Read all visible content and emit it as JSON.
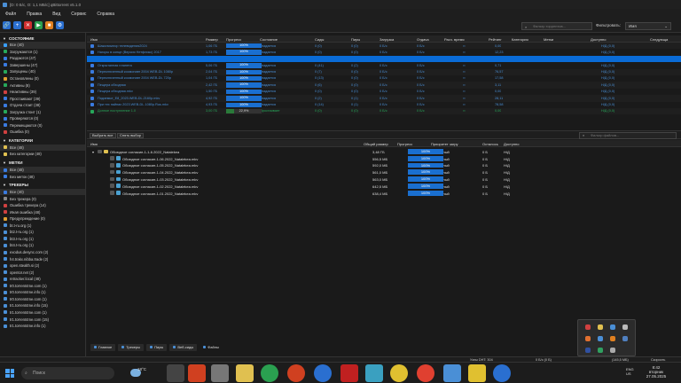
{
  "window": {
    "title": "[D: 0 Б/с, О: 1,1 МБ/с] qBittorrent v5.1.0"
  },
  "menu": [
    "Файл",
    "Правка",
    "Вид",
    "Сервис",
    "Справка"
  ],
  "toolbar": {
    "search_placeholder": "Фильтр торрентов...",
    "filter_label": "Фильтровать:",
    "filter_value": "Имя"
  },
  "sidebar": {
    "status_title": "СОСТОЯНИЕ",
    "status_items": [
      {
        "label": "Все (40)",
        "color": "#3aa0ff",
        "selected": true
      },
      {
        "label": "Загружаются (1)",
        "color": "#27a85a"
      },
      {
        "label": "Раздаются (47)",
        "color": "#3a7be0"
      },
      {
        "label": "Завершены (47)",
        "color": "#3a7be0"
      },
      {
        "label": "Запущены (40)",
        "color": "#27a85a"
      },
      {
        "label": "Остановлены (0)",
        "color": "#e0a030"
      },
      {
        "label": "Активны (8)",
        "color": "#27a85a"
      },
      {
        "label": "Неактивны (39)",
        "color": "#d04040"
      },
      {
        "label": "Простаивают (39)",
        "color": "#3a7be0"
      },
      {
        "label": "Отдача стоит (38)",
        "color": "#3a7be0"
      },
      {
        "label": "Загрузка стоит (1)",
        "color": "#27a85a"
      },
      {
        "label": "Проверяются (0)",
        "color": "#3a7be0"
      },
      {
        "label": "Перемещаются (0)",
        "color": "#3a7be0"
      },
      {
        "label": "Ошибка (0)",
        "color": "#d04040"
      }
    ],
    "categories_title": "КАТЕГОРИИ",
    "category_items": [
      {
        "label": "Все (48)",
        "color": "#e0c050",
        "selected": true
      },
      {
        "label": "Без категории (48)",
        "color": "#e0c050"
      }
    ],
    "tags_title": "МЕТКИ",
    "tag_items": [
      {
        "label": "Все (48)",
        "color": "#3a7be0",
        "selected": true
      },
      {
        "label": "Без меток (48)",
        "color": "#3a7be0"
      }
    ],
    "trackers_title": "ТРЕКЕРЫ",
    "tracker_items": [
      {
        "label": "Все (40)",
        "color": "#3a7be0",
        "selected": true
      },
      {
        "label": "Без трекера (0)",
        "color": "#888"
      },
      {
        "label": "Ошибка трекера (14)",
        "color": "#d04040"
      },
      {
        "label": "Иная ошибка (48)",
        "color": "#d04040"
      },
      {
        "label": "Предупреждение (0)",
        "color": "#e0a030"
      },
      {
        "label": "bt.t-ru.org (1)",
        "color": "#4a8fd6"
      },
      {
        "label": "bt2.t-ru.org (1)",
        "color": "#4a8fd6"
      },
      {
        "label": "bt3.t-ru.org (1)",
        "color": "#4a8fd6"
      },
      {
        "label": "bt4.t-ru.org (1)",
        "color": "#4a8fd6"
      },
      {
        "label": "exodus.desync.com (2)",
        "color": "#4a8fd6"
      },
      {
        "label": "h4.trakx.nibba.trade (2)",
        "color": "#4a8fd6"
      },
      {
        "label": "open.stealth.si (2)",
        "color": "#4a8fd6"
      },
      {
        "label": "opentor.net (2)",
        "color": "#4a8fd6"
      },
      {
        "label": "retracker.local (48)",
        "color": "#4a8fd6"
      },
      {
        "label": "tr0.torrent4me.com (1)",
        "color": "#4a8fd6"
      },
      {
        "label": "tr0.torrent4me.info (1)",
        "color": "#4a8fd6"
      },
      {
        "label": "tr0.torrent4me.com (1)",
        "color": "#4a8fd6"
      },
      {
        "label": "tr1.torrent4me.info (15)",
        "color": "#4a8fd6"
      },
      {
        "label": "tr1.torrent4me.com (1)",
        "color": "#4a8fd6"
      },
      {
        "label": "tr1.torrent4me.com (15)",
        "color": "#4a8fd6"
      },
      {
        "label": "tr1.torrent4me.info (1)",
        "color": "#4a8fd6"
      }
    ]
  },
  "torrent_table": {
    "columns": [
      "Имя",
      "Размер",
      "Прогресс",
      "Состояние",
      "Сиды",
      "Пиры",
      "Загрузка",
      "Отдача",
      "Расч. время",
      "Рейтинг",
      "Категория",
      "Метки",
      "Доступно",
      "Следующа"
    ],
    "rows": [
      {
        "name": "Шакализатор телевидения2024",
        "size": "1,06 ГБ",
        "progress": "100%",
        "state": "Раздается",
        "seeds": "0 (0)",
        "peers": "0 (0)",
        "down": "0 Б/с",
        "up": "0 Б/с",
        "eta": "∞",
        "ratio": "0,00",
        "avail": "Н/Д (0,0)"
      },
      {
        "name": "Нагоры в конце (Версия Нетфликс) 2017",
        "size": "1,73 ГБ",
        "progress": "100%",
        "state": "Раздается",
        "seeds": "0 (0)",
        "peers": "0 (0)",
        "down": "0 Б/с",
        "up": "0 Б/с",
        "eta": "∞",
        "ratio": "12,23",
        "avail": "Н/Д (0,0)"
      },
      {
        "name": "",
        "size": "",
        "progress": "",
        "state": "",
        "seeds": "",
        "peers": "",
        "down": "",
        "up": "",
        "eta": "",
        "ratio": "",
        "avail": "",
        "highlight": true
      },
      {
        "name": "Открытанная планета",
        "size": "5,06 ГБ",
        "progress": "100%",
        "state": "Раздается",
        "seeds": "0 (41)",
        "peers": "0 (2)",
        "down": "0 Б/с",
        "up": "0 Б/с",
        "eta": "∞",
        "ratio": "0,71",
        "avail": "Н/Д (0,0)"
      },
      {
        "name": "Переключенный космонавт 2004 WEB-DL 1080p",
        "size": "2,04 ГБ",
        "progress": "100%",
        "state": "Раздается",
        "seeds": "0 (7)",
        "peers": "0 (0)",
        "down": "0 Б/с",
        "up": "0 Б/с",
        "eta": "∞",
        "ratio": "76,57",
        "avail": "Н/Д (0,0)"
      },
      {
        "name": "Переключенный космонавт 2004 WEB-DL 720p",
        "size": "1,04 ГБ",
        "progress": "100%",
        "state": "Раздается",
        "seeds": "0 (13)",
        "peers": "0 (0)",
        "down": "0 Б/с",
        "up": "0 Б/с",
        "eta": "∞",
        "ratio": "17,58",
        "avail": "Н/Д (0,0)"
      },
      {
        "name": "Пещера обходная",
        "size": "2,42 ГБ",
        "progress": "100%",
        "state": "Раздается",
        "seeds": "0 (6)",
        "peers": "0 (0)",
        "down": "0 Б/с",
        "up": "0 Б/с",
        "eta": "∞",
        "ratio": "3,11",
        "avail": "Н/Д (0,0)"
      },
      {
        "name": "Пещера обходная.mkv",
        "size": "1,50 ГБ",
        "progress": "100%",
        "state": "Раздается",
        "seeds": "0 (0)",
        "peers": "0 (0)",
        "down": "0 Б/с",
        "up": "0 Б/с",
        "eta": "∞",
        "ratio": "0,00",
        "avail": "Н/Д (0,0)"
      },
      {
        "name": "Подземье_Е8_2023.WEB-DL.2160p.mkv",
        "size": "4,92 ГБ",
        "progress": "100%",
        "state": "Раздается",
        "seeds": "0 (2)",
        "peers": "0 (1)",
        "down": "0 Б/с",
        "up": "0 Б/с",
        "eta": "∞",
        "ratio": "28,11",
        "avail": "Н/Д (0,0)"
      },
      {
        "name": "При тех пайнах 2023.WEB-DL.1080p.Rus.mkv",
        "size": "4,93 ГБ",
        "progress": "100%",
        "state": "Раздается",
        "seeds": "0 (14)",
        "peers": "0 (1)",
        "down": "0 Б/с",
        "up": "0 Б/с",
        "eta": "∞",
        "ratio": "78,58",
        "avail": "Н/Д (0,0)"
      },
      {
        "name": "Донное поступление 1.0",
        "size": "3,00 ГБ",
        "progress": "22,9%",
        "state": "Простаивает",
        "seeds": "0 (0)",
        "peers": "0 (0)",
        "down": "0 Б/с",
        "up": "0 Б/с",
        "eta": "∞",
        "ratio": "0,00",
        "avail": "Н/Д (0,0)",
        "last": true,
        "fill": 0.229
      }
    ]
  },
  "middle_bar": {
    "select_all": "Выбрать все",
    "deselect": "Снять выбор",
    "file_filter": "Фильтр файлов..."
  },
  "files_table": {
    "columns": [
      "Имя",
      "Общий размер",
      "Прогресс",
      "Приоритет загру",
      "Осталось",
      "Доступно"
    ],
    "folder": {
      "name": "Обоюдное согласие-1-1-6.2022_Natalekea",
      "size": "3,48 ГБ",
      "progress": "100%",
      "priority": "Обычный",
      "remaining": "0 Б",
      "avail": "Н/Д"
    },
    "files": [
      {
        "name": "Обоюдное согласие-1-06.2022_Natalekea.mkv",
        "size": "556,5 МБ",
        "progress": "100%",
        "priority": "Обычный",
        "remaining": "0 Б",
        "avail": "Н/Д"
      },
      {
        "name": "Обоюдное согласие-1-05.2022_Natalekea.mkv",
        "size": "592,0 МБ",
        "progress": "100%",
        "priority": "Обычный",
        "remaining": "0 Б",
        "avail": "Н/Д"
      },
      {
        "name": "Обоюдное согласие-1-04.2022_Natalekea.mkv",
        "size": "561,0 МБ",
        "progress": "100%",
        "priority": "Обычный",
        "remaining": "0 Б",
        "avail": "Н/Д"
      },
      {
        "name": "Обоюдное согласие-1-03.2022_Natalekea.mkv",
        "size": "563,0 МБ",
        "progress": "100%",
        "priority": "Обычный",
        "remaining": "0 Б",
        "avail": "Н/Д"
      },
      {
        "name": "Обоюдное согласие-1-02.2022_Natalekea.mkv",
        "size": "642,5 МБ",
        "progress": "100%",
        "priority": "Обычный",
        "remaining": "0 Б",
        "avail": "Н/Д"
      },
      {
        "name": "Обоюдное согласие-1-01.2022_Natalekea.mkv",
        "size": "638,4 МБ",
        "progress": "100%",
        "priority": "Обычный",
        "remaining": "0 Б",
        "avail": "Н/Д"
      }
    ]
  },
  "bottom_tabs": [
    "Главное",
    "Трекеры",
    "Пиры",
    "Веб-сиды",
    "Файлы"
  ],
  "status_bar": {
    "dht": "Узлы DHT: 304",
    "down": "0 Б/с (0 Б)",
    "up": "(145,5 МБ)",
    "speed_btn": "Скорость"
  },
  "taskbar": {
    "search": "Поиск",
    "temp": "18°C",
    "lang": "ENG\nUS",
    "time": "8:42",
    "day": "вторник",
    "date": "27.05.2025"
  }
}
